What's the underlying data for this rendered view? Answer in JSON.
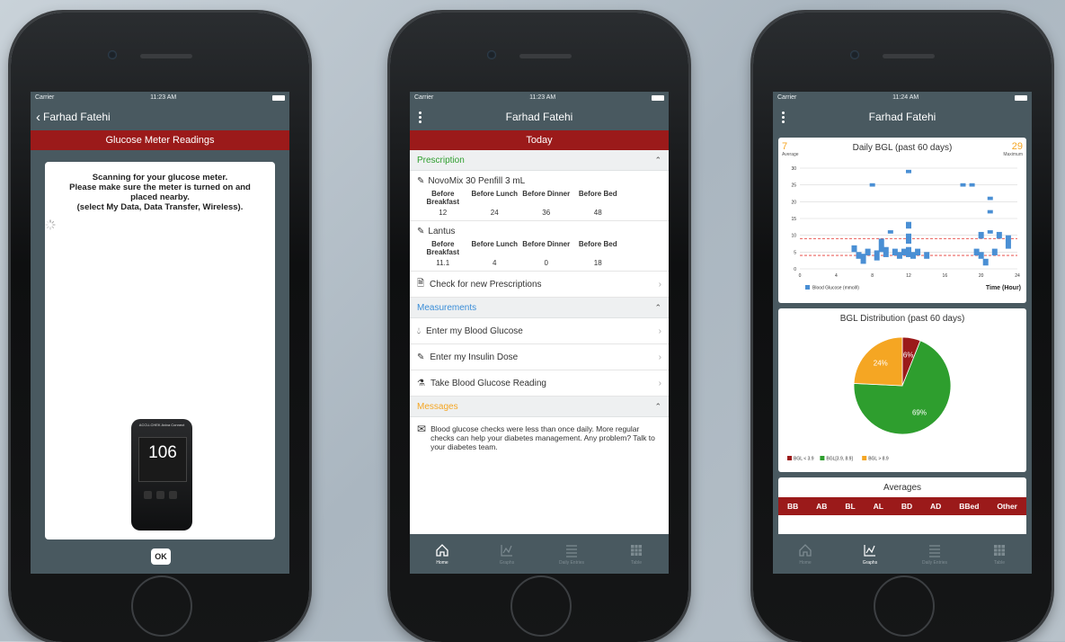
{
  "colors": {
    "accent_red": "#9b1a1a",
    "nav_bg": "#495960",
    "green": "#2e9e2e",
    "blue": "#3b8ed8",
    "orange": "#f5a623",
    "bar_blue": "#4a8fd4"
  },
  "phone1": {
    "status": {
      "carrier": "Carrier",
      "time": "11:23 AM"
    },
    "nav": {
      "back_label": "Farhad Fatehi"
    },
    "header": "Glucose Meter Readings",
    "scan_message_lines": [
      "Scanning for your glucose meter.",
      "Please make sure the meter is turned on and",
      "placed nearby.",
      "(select My Data, Data Transfer, Wireless)."
    ],
    "meter": {
      "brand": "ACCU-CHEK Aviva Connect",
      "reading": "106"
    },
    "ok_label": "OK"
  },
  "phone2": {
    "status": {
      "carrier": "Carrier",
      "time": "11:23 AM"
    },
    "nav": {
      "title": "Farhad Fatehi"
    },
    "header": "Today",
    "prescription": {
      "title": "Prescription",
      "headers": [
        "Before Breakfast",
        "Before Lunch",
        "Before Dinner",
        "Before Bed"
      ],
      "meds": [
        {
          "name": "NovoMix 30 Penfill 3 mL",
          "doses": [
            "12",
            "24",
            "36",
            "48"
          ]
        },
        {
          "name": "Lantus",
          "doses": [
            "11.1",
            "4",
            "0",
            "18"
          ]
        }
      ],
      "check_label": "Check for new Prescriptions"
    },
    "measurements": {
      "title": "Measurements",
      "items": [
        "Enter my Blood Glucose",
        "Enter my Insulin Dose",
        "Take Blood Glucose Reading"
      ]
    },
    "messages": {
      "title": "Messages",
      "text": "Blood glucose checks were less than once daily. More regular checks can help your diabetes management. Any problem? Talk to your diabetes team."
    },
    "tabs": [
      "Home",
      "Graphs",
      "Daily Entries",
      "Table"
    ]
  },
  "phone3": {
    "status": {
      "carrier": "Carrier",
      "time": "11:24 AM"
    },
    "nav": {
      "title": "Farhad Fatehi"
    },
    "bgl_chart": {
      "avg_value": "7",
      "avg_label": "Average",
      "max_value": "29",
      "max_label": "Maximum"
    },
    "dist_chart": {},
    "averages": {
      "title": "Averages",
      "cols": [
        "BB",
        "AB",
        "BL",
        "AL",
        "BD",
        "AD",
        "BBed",
        "Other"
      ]
    },
    "tabs": [
      "Home",
      "Graphs",
      "Daily Entries",
      "Table"
    ]
  },
  "chart_data": [
    {
      "type": "bar",
      "title": "Daily BGL (past 60 days)",
      "xlabel": "Time (Hour)",
      "ylabel": "",
      "xlim": [
        0,
        24
      ],
      "ylim": [
        0,
        30
      ],
      "xticks": [
        0,
        4,
        8,
        12,
        16,
        20,
        24
      ],
      "yticks": [
        0,
        5,
        10,
        15,
        20,
        25,
        30
      ],
      "reference_lines": [
        9,
        4
      ],
      "series": [
        {
          "name": "Blood Glucose (mmol/l)",
          "points": [
            [
              6,
              6,
              2
            ],
            [
              6.5,
              4,
              2
            ],
            [
              7,
              3,
              3
            ],
            [
              7.5,
              5,
              2
            ],
            [
              8,
              25,
              1
            ],
            [
              8.5,
              4,
              3
            ],
            [
              9,
              7,
              4
            ],
            [
              9.5,
              5,
              3
            ],
            [
              10,
              11,
              1
            ],
            [
              10.5,
              5,
              2
            ],
            [
              11,
              4,
              2
            ],
            [
              11.5,
              5,
              2
            ],
            [
              12,
              13,
              2
            ],
            [
              12,
              9,
              3
            ],
            [
              12,
              5,
              3
            ],
            [
              12,
              29,
              1
            ],
            [
              12.5,
              4,
              2
            ],
            [
              13,
              5,
              2
            ],
            [
              14,
              4,
              2
            ],
            [
              18,
              25,
              1
            ],
            [
              19,
              25,
              1
            ],
            [
              19.5,
              5,
              2
            ],
            [
              20,
              10,
              2
            ],
            [
              20,
              4,
              2
            ],
            [
              20.5,
              2,
              2
            ],
            [
              21,
              11,
              1
            ],
            [
              21,
              17,
              1
            ],
            [
              21,
              21,
              1
            ],
            [
              21.5,
              5,
              2
            ],
            [
              22,
              10,
              2
            ],
            [
              23,
              8,
              4
            ]
          ]
        }
      ]
    },
    {
      "type": "pie",
      "title": "BGL Distribution (past 60 days)",
      "slices": [
        {
          "label": "BGL < 3.9",
          "value": 6
        },
        {
          "label": "BGL[3.9, 8.9]",
          "value": 69
        },
        {
          "label": "BGL > 8.9",
          "value": 24
        }
      ]
    }
  ]
}
